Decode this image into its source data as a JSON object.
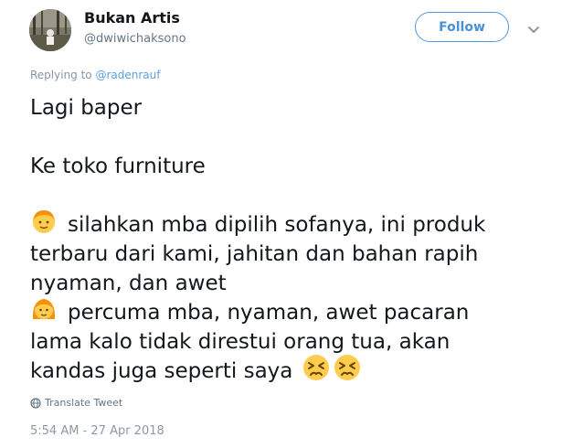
{
  "author": {
    "name": "Bukan Artis",
    "handle": "@dwiwichaksono"
  },
  "follow_label": "Follow",
  "reply": {
    "prefix": "Replying to ",
    "to": "@radenrauf"
  },
  "tweet": {
    "line1": "Lagi baper",
    "line2": "Ke toko furniture",
    "line3": "silahkan mba dipilih sofanya, ini produk",
    "line4": "terbaru dari kami, jahitan dan bahan rapih",
    "line5": "nyaman, dan awet",
    "line6": "percuma mba, nyaman, awet pacaran",
    "line7": "lama kalo tidak direstui orang tua, akan",
    "line8": "kandas juga seperti saya"
  },
  "translate_label": "Translate Tweet",
  "timestamp": "5:54 AM - 27 Apr 2018",
  "icons": {
    "boy": "boy-emoji-icon",
    "girl": "girl-emoji-icon",
    "persevering": "persevering-face-emoji-icon",
    "globe": "globe-icon",
    "chevron": "chevron-down-icon"
  },
  "colors": {
    "accent": "#4a90d9",
    "muted": "#657786",
    "text": "#14171a"
  }
}
